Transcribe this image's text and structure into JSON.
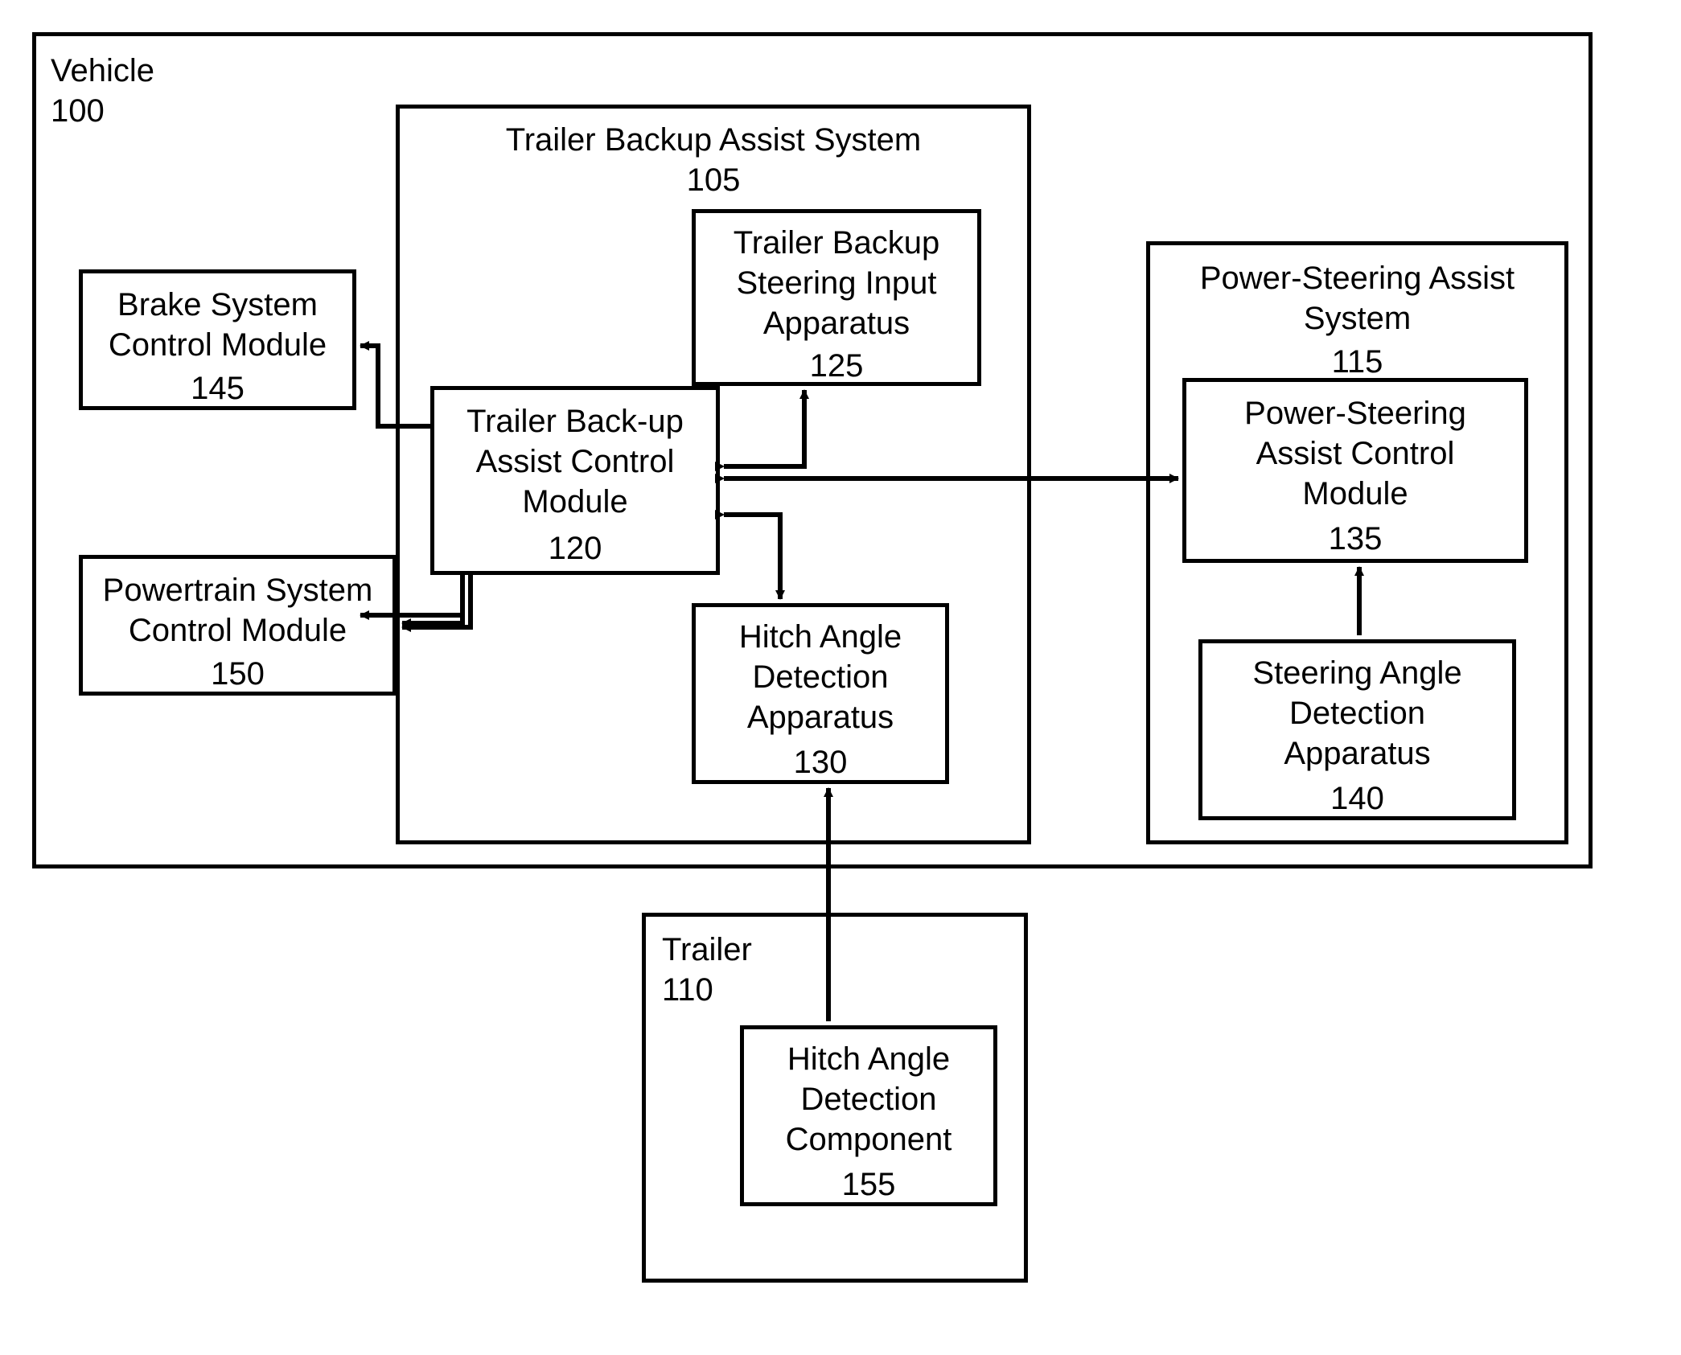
{
  "vehicle": {
    "title": "Vehicle",
    "ref": "100"
  },
  "tbas": {
    "title": "Trailer Backup Assist System",
    "ref": "105"
  },
  "tbsia": {
    "title": "Trailer Backup\nSteering Input\nApparatus",
    "ref": "125"
  },
  "tbacm": {
    "title": "Trailer Back-up\nAssist Control\nModule",
    "ref": "120"
  },
  "hada": {
    "title": "Hitch Angle\nDetection\nApparatus",
    "ref": "130"
  },
  "bscm": {
    "title": "Brake System\nControl Module",
    "ref": "145"
  },
  "pscm": {
    "title": "Powertrain System\nControl Module",
    "ref": "150"
  },
  "psas": {
    "title": "Power-Steering Assist\nSystem",
    "ref": "115"
  },
  "psacm": {
    "title": "Power-Steering\nAssist Control\nModule",
    "ref": "135"
  },
  "sada": {
    "title": "Steering Angle\nDetection\nApparatus",
    "ref": "140"
  },
  "trailer": {
    "title": "Trailer",
    "ref": "110"
  },
  "hadc": {
    "title": "Hitch Angle\nDetection\nComponent",
    "ref": "155"
  }
}
